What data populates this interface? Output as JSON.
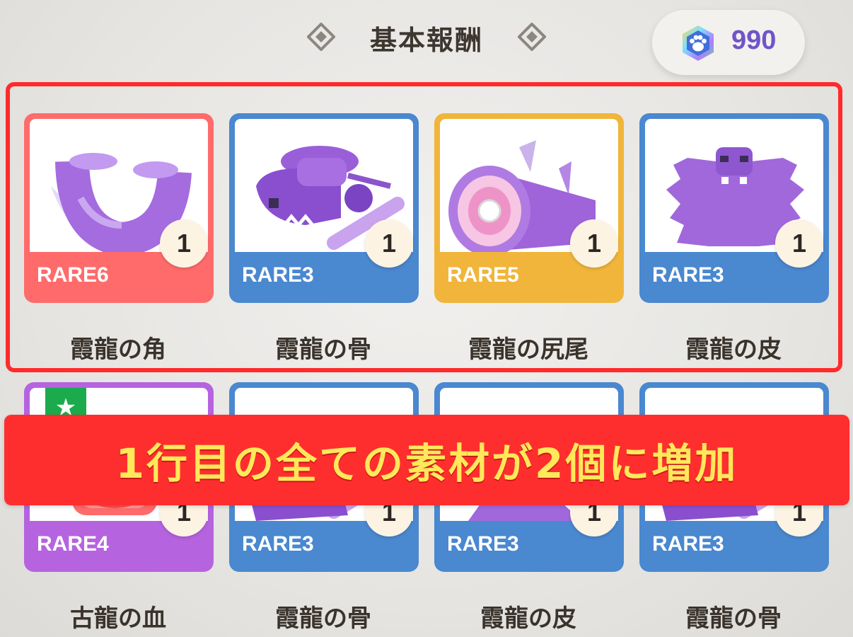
{
  "header": {
    "title": "基本報酬"
  },
  "currency": {
    "value": "990",
    "icon": "paw-gem-icon"
  },
  "colors": {
    "rare6": "#ff6b6b",
    "rare5": "#f0b53a",
    "rare4": "#b663e0",
    "rare3": "#4a88d0",
    "highlight": "#ff2b2b",
    "banner_bg": "#ff2e2e",
    "banner_text": "#ffe85a"
  },
  "rows": [
    {
      "items": [
        {
          "rarity": "RARE6",
          "qty": "1",
          "name": "霞龍の角",
          "icon": "dragon-horn-icon"
        },
        {
          "rarity": "RARE3",
          "qty": "1",
          "name": "霞龍の骨",
          "icon": "dragon-skull-bone-icon"
        },
        {
          "rarity": "RARE5",
          "qty": "1",
          "name": "霞龍の尻尾",
          "icon": "dragon-tail-icon"
        },
        {
          "rarity": "RARE3",
          "qty": "1",
          "name": "霞龍の皮",
          "icon": "dragon-hide-icon"
        }
      ]
    },
    {
      "items": [
        {
          "rarity": "RARE4",
          "qty": "1",
          "name": "古龍の血",
          "icon": "elder-dragon-blood-icon",
          "badge": "★"
        },
        {
          "rarity": "RARE3",
          "qty": "1",
          "name": "霞龍の骨",
          "icon": "dragon-skull-bone-icon"
        },
        {
          "rarity": "RARE3",
          "qty": "1",
          "name": "霞龍の皮",
          "icon": "dragon-hide-icon"
        },
        {
          "rarity": "RARE3",
          "qty": "1",
          "name": "霞龍の骨",
          "icon": "dragon-skull-bone-icon"
        }
      ]
    }
  ],
  "banner": {
    "text": "1行目の全ての素材が2個に増加"
  }
}
